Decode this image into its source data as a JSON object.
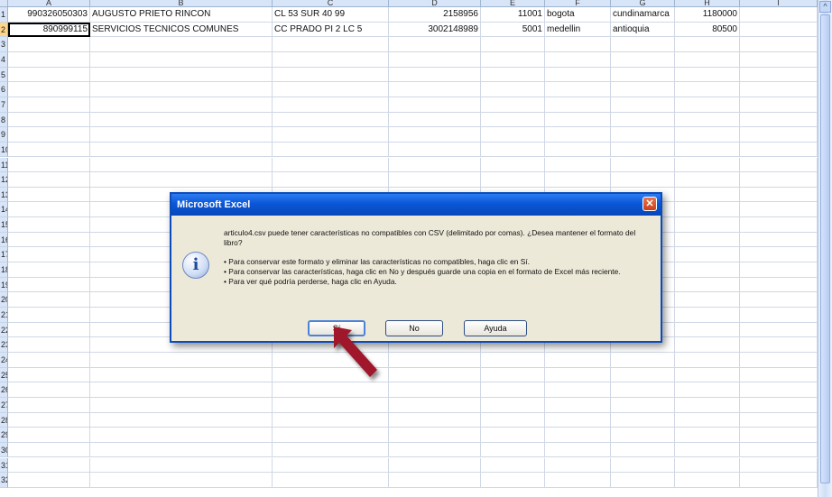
{
  "columns": [
    "A",
    "B",
    "C",
    "D",
    "E",
    "F",
    "G",
    "H",
    "I"
  ],
  "rows": [
    "1",
    "2",
    "3",
    "4",
    "5",
    "6",
    "7",
    "8",
    "9",
    "10",
    "11",
    "12",
    "13",
    "14",
    "15",
    "16",
    "17",
    "18",
    "19",
    "20",
    "21",
    "22",
    "23",
    "24",
    "25",
    "26",
    "27",
    "28",
    "29",
    "30",
    "31",
    "32"
  ],
  "cells": [
    {
      "col": "A",
      "row": 1,
      "value": "990326050303",
      "num": true
    },
    {
      "col": "B",
      "row": 1,
      "value": "AUGUSTO PRIETO RINCON",
      "num": false
    },
    {
      "col": "C",
      "row": 1,
      "value": "CL 53 SUR 40 99",
      "num": false
    },
    {
      "col": "D",
      "row": 1,
      "value": "2158956",
      "num": true
    },
    {
      "col": "E",
      "row": 1,
      "value": "11001",
      "num": true
    },
    {
      "col": "F",
      "row": 1,
      "value": "bogota",
      "num": false
    },
    {
      "col": "G",
      "row": 1,
      "value": "cundinamarca",
      "num": false
    },
    {
      "col": "H",
      "row": 1,
      "value": "1180000",
      "num": true
    },
    {
      "col": "A",
      "row": 2,
      "value": "890999115",
      "num": true
    },
    {
      "col": "B",
      "row": 2,
      "value": "SERVICIOS TECNICOS COMUNES",
      "num": false
    },
    {
      "col": "C",
      "row": 2,
      "value": "CC PRADO PI 2 LC 5",
      "num": false
    },
    {
      "col": "D",
      "row": 2,
      "value": "3002148989",
      "num": true
    },
    {
      "col": "E",
      "row": 2,
      "value": "5001",
      "num": true
    },
    {
      "col": "F",
      "row": 2,
      "value": "medellin",
      "num": false
    },
    {
      "col": "G",
      "row": 2,
      "value": "antioquia",
      "num": false
    },
    {
      "col": "H",
      "row": 2,
      "value": "80500",
      "num": true
    }
  ],
  "active_cell": "A2",
  "scrollbar": {
    "up_arrow": "^"
  },
  "dialog": {
    "title": "Microsoft Excel",
    "close_glyph": "✕",
    "icon_glyph": "i",
    "message": "articulo4.csv puede tener características no compatibles con CSV (delimitado por comas). ¿Desea mantener el formato del libro?",
    "bullets": [
      "• Para conservar este formato y eliminar las características no compatibles, haga clic en Sí.",
      "• Para conservar las características, haga clic en No y después guarde una copia en el formato de Excel más reciente.",
      "• Para ver qué podría perderse, haga clic en Ayuda."
    ],
    "buttons": {
      "yes": "Sí",
      "no": "No",
      "help": "Ayuda"
    }
  },
  "annotation": {
    "arrow_color": "#a0182a"
  }
}
